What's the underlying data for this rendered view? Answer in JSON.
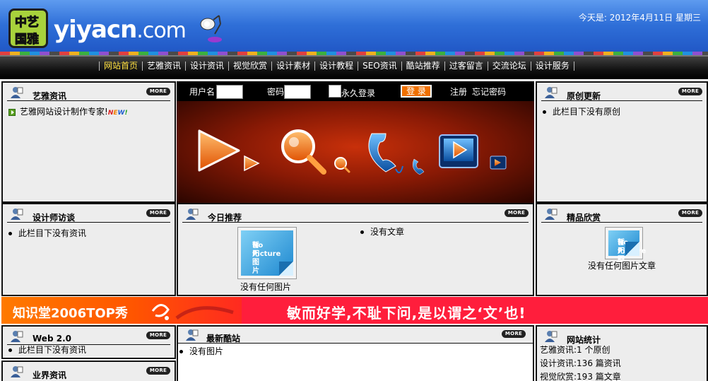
{
  "header": {
    "logo_cn": [
      "中艺",
      "国雅"
    ],
    "logo_text": "yiyacn",
    "logo_tld": ".com",
    "date": "今天是: 2012年4月11日 星期三",
    "accent": "#2f6fd8"
  },
  "nav": {
    "items": [
      "网站首页",
      "艺雅资讯",
      "设计资讯",
      "视觉欣赏",
      "设计素材",
      "设计教程",
      "SEO资讯",
      "酷站推荐",
      "过客留言",
      "交流论坛",
      "设计服务"
    ],
    "active_color": "#ffe040"
  },
  "more_label": "MORE",
  "left_top": {
    "title": "艺雅资讯",
    "item": "艺雅网站设计制作专家!",
    "badge": "NEW!"
  },
  "login": {
    "username_label": "用户名",
    "password_label": "密码",
    "remember_label": "永久登录",
    "login_button": "登 录",
    "register_link": "注册",
    "forgot_link": "忘记密码"
  },
  "right_top": {
    "title": "原创更新",
    "item": "此栏目下没有原创"
  },
  "left_mid": {
    "title": "设计师访谈",
    "item": "此栏目下没有资讯"
  },
  "center_mid": {
    "title": "今日推荐",
    "no_pic_caption": "没有任何图片",
    "no_article": "没有文章"
  },
  "right_mid": {
    "title": "精品欣赏",
    "caption": "没有任何图片文章"
  },
  "nopic_label": [
    "No Picture",
    "暂无图片"
  ],
  "ad": {
    "left_text": "知识堂2006TOP秀",
    "right_text": "敏而好学,不耻下问,是以谓之‘文’也!"
  },
  "left_bottom": {
    "title": "Web 2.0",
    "item": "此栏目下没有资讯",
    "title2": "业界资讯"
  },
  "center_bottom": {
    "title": "最新酷站",
    "item": "没有图片"
  },
  "right_bottom": {
    "title": "网站统计",
    "stats": [
      "艺雅资讯:1 个原创",
      "设计资讯:136 篇资讯",
      "视觉欣赏:193 篇文章"
    ]
  }
}
